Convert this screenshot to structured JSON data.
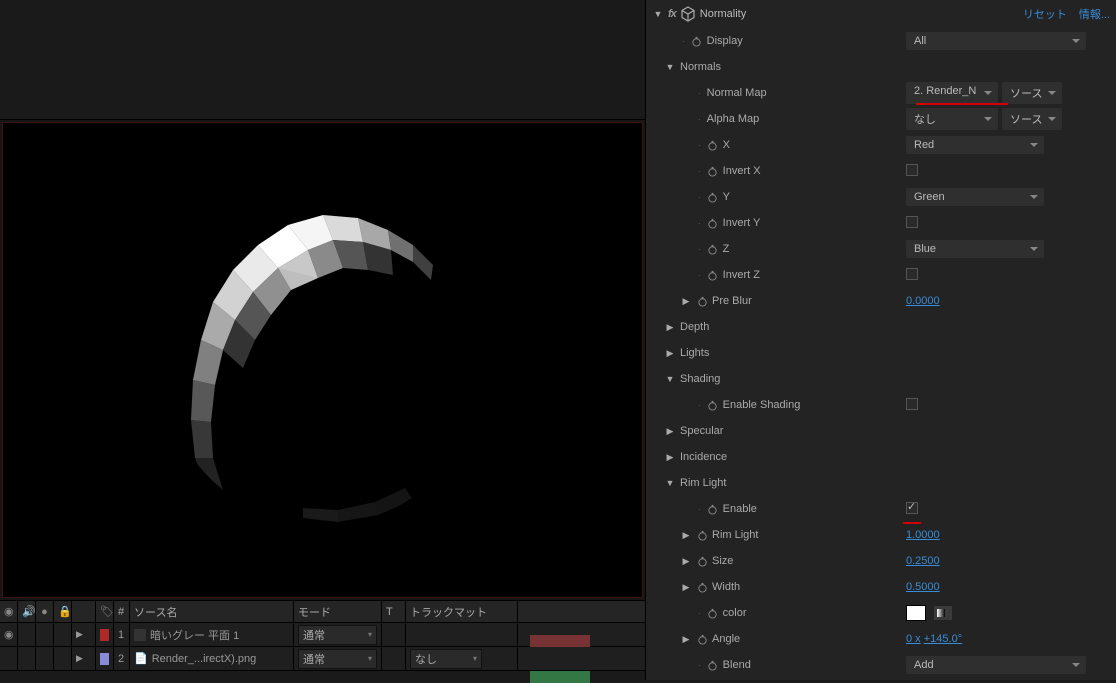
{
  "effect": {
    "name": "Normality",
    "reset": "リセット",
    "info": "情報..."
  },
  "props": {
    "display": {
      "label": "Display",
      "value": "All"
    },
    "normals": {
      "label": "Normals",
      "normal_map": {
        "label": "Normal Map",
        "value": "2. Render_N",
        "source": "ソース"
      },
      "alpha_map": {
        "label": "Alpha Map",
        "value": "なし",
        "source": "ソース"
      },
      "x": {
        "label": "X",
        "value": "Red"
      },
      "invert_x": {
        "label": "Invert X"
      },
      "y": {
        "label": "Y",
        "value": "Green"
      },
      "invert_y": {
        "label": "Invert Y"
      },
      "z": {
        "label": "Z",
        "value": "Blue"
      },
      "invert_z": {
        "label": "Invert Z"
      },
      "pre_blur": {
        "label": "Pre Blur",
        "value": "0.0000"
      }
    },
    "depth": {
      "label": "Depth"
    },
    "lights": {
      "label": "Lights"
    },
    "shading": {
      "label": "Shading",
      "enable": {
        "label": "Enable Shading"
      }
    },
    "specular": {
      "label": "Specular"
    },
    "incidence": {
      "label": "Incidence"
    },
    "rim": {
      "label": "Rim Light",
      "enable": {
        "label": "Enable"
      },
      "rim_light": {
        "label": "Rim Light",
        "value": "1.0000"
      },
      "size": {
        "label": "Size",
        "value": "0.2500"
      },
      "width": {
        "label": "Width",
        "value": "0.5000"
      },
      "color": {
        "label": "color"
      },
      "angle": {
        "label": "Angle",
        "value_a": "0 x",
        "value_b": "+145.0°"
      },
      "blend": {
        "label": "Blend",
        "value": "Add"
      }
    }
  },
  "timeline": {
    "cols": {
      "num": "#",
      "source": "ソース名",
      "mode": "モード",
      "t": "T",
      "track": "トラックマット"
    },
    "rows": [
      {
        "num": "1",
        "name": "暗いグレー 平面 1",
        "mode": "通常",
        "matte": "",
        "color": "#b02828"
      },
      {
        "num": "2",
        "name": "Render_...irectX).png",
        "mode": "通常",
        "matte": "なし",
        "color": "#8a8ad6"
      }
    ]
  }
}
